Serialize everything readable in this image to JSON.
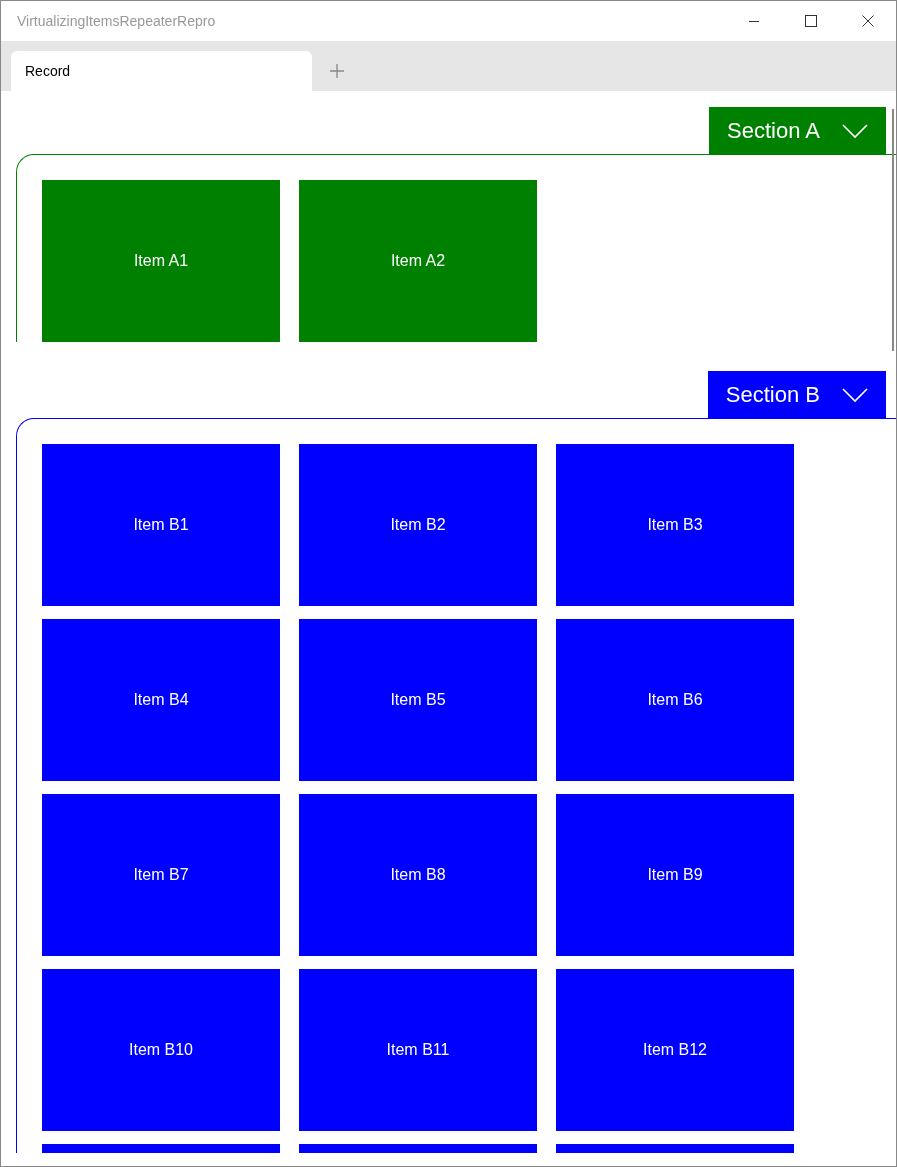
{
  "window": {
    "title": "VirtualizingItemsRepeaterRepro"
  },
  "tabs": [
    {
      "label": "Record",
      "selected": true
    }
  ],
  "sections": [
    {
      "title": "Section A",
      "color": "#008000",
      "expanded": true,
      "items": [
        {
          "kind": "tile",
          "label": "Item A1"
        },
        {
          "kind": "tile",
          "label": "Item A2"
        }
      ]
    },
    {
      "title": "Section B",
      "color": "#0000ff",
      "expanded": true,
      "items": [
        {
          "kind": "tile",
          "label": "Item B1"
        },
        {
          "kind": "tile",
          "label": "Item B2"
        },
        {
          "kind": "tile",
          "label": "Item B3"
        },
        {
          "kind": "tile",
          "label": "Item B4"
        },
        {
          "kind": "tile",
          "label": "Item B5"
        },
        {
          "kind": "tile",
          "label": "Item B6"
        },
        {
          "kind": "tile",
          "label": "Item B7"
        },
        {
          "kind": "tile",
          "label": "Item B8"
        },
        {
          "kind": "tile",
          "label": "Item B9"
        },
        {
          "kind": "tile",
          "label": "Item B10"
        },
        {
          "kind": "tile",
          "label": "Item B11"
        },
        {
          "kind": "tile",
          "label": "Item B12"
        },
        {
          "kind": "cut"
        },
        {
          "kind": "cut"
        },
        {
          "kind": "cut"
        }
      ]
    }
  ]
}
